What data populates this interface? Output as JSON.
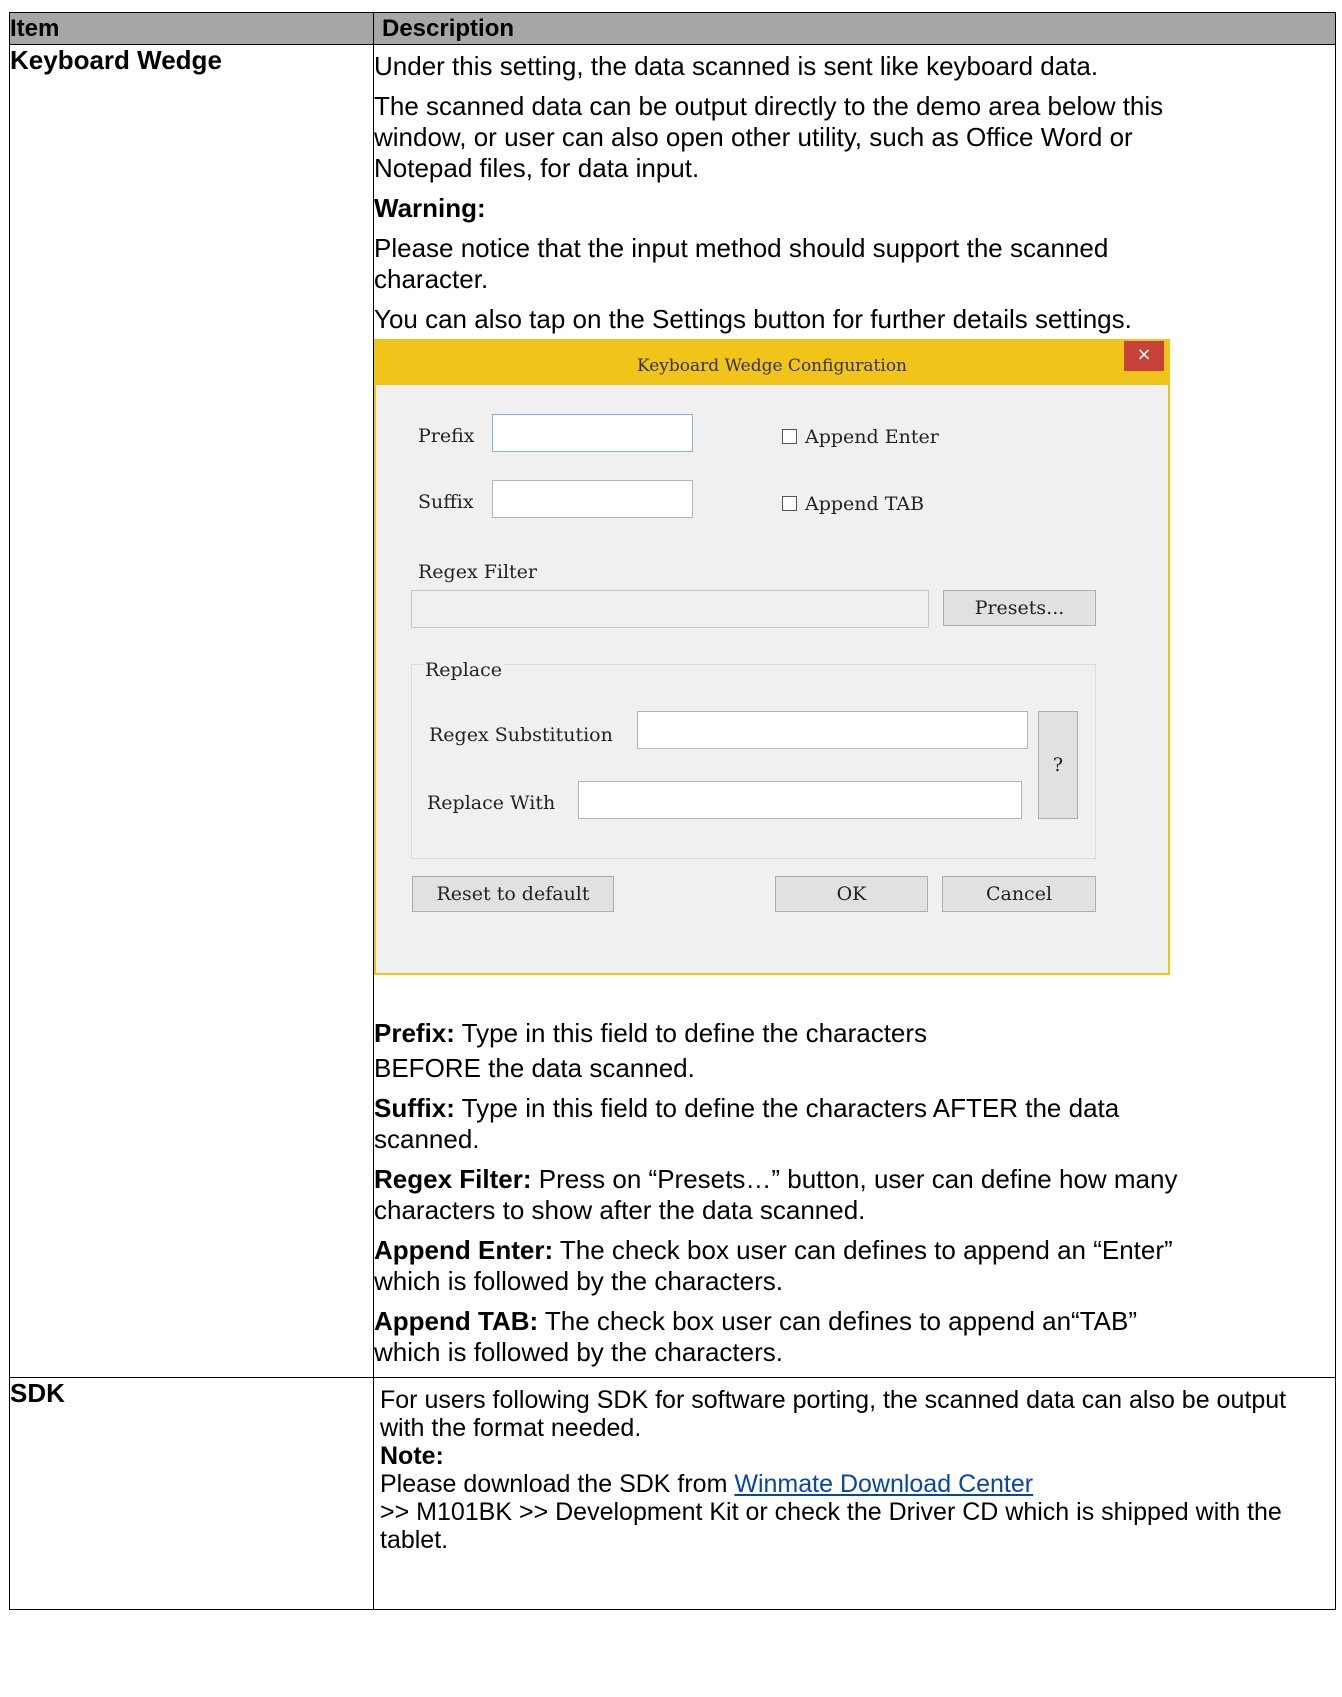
{
  "table": {
    "header_item": "Item",
    "header_description": "Description"
  },
  "row_keyboard": {
    "item": "Keyboard Wedge",
    "p1": "Under this setting, the data scanned is sent like keyboard data.",
    "p2": "The scanned data can be output directly to the demo area below this window, or user can also open other utility, such as Office Word or Notepad files, for data input.",
    "warning_label": "Warning:",
    "p3": "Please notice that the input method should support the scanned character.",
    "p4": "You can also tap on the Settings button for further details settings.",
    "prefix_label": "Prefix:",
    "prefix_text": " Type in this field to define the characters",
    "prefix_text2": "BEFORE the data scanned.",
    "suffix_label": "Suffix:",
    "suffix_text": " Type in this field to define the characters AFTER the data scanned.",
    "regex_label": "Regex Filter:",
    "regex_text": " Press on “Presets…” button, user can define how many characters to show after the data scanned.",
    "enter_label": "Append Enter:",
    "enter_text": " The check box user can defines to append an “Enter” which is followed by the characters.",
    "tab_label": "Append TAB:",
    "tab_text": " The check box user can defines to append an“TAB” which is followed by the characters."
  },
  "dialog": {
    "title": "Keyboard Wedge Configuration",
    "close_glyph": "×",
    "prefix": "Prefix",
    "suffix": "Suffix",
    "append_enter": "Append Enter",
    "append_tab": "Append TAB",
    "regex_filter": "Regex Filter",
    "presets": "Presets...",
    "replace": "Replace",
    "regex_substitution": "Regex Substitution",
    "replace_with": "Replace With",
    "help": "?",
    "reset": "Reset to default",
    "ok": "OK",
    "cancel": "Cancel",
    "accent": "#f0c419"
  },
  "row_sdk": {
    "item": "SDK",
    "p1": "For users following SDK for software porting, the scanned data can also be output with the format needed.",
    "note_label": "Note:",
    "p2_before": "Please download the SDK from ",
    "link": "Winmate Download Center",
    "p3": ">> M101BK >> Development Kit or check the Driver CD which is shipped with the tablet."
  }
}
